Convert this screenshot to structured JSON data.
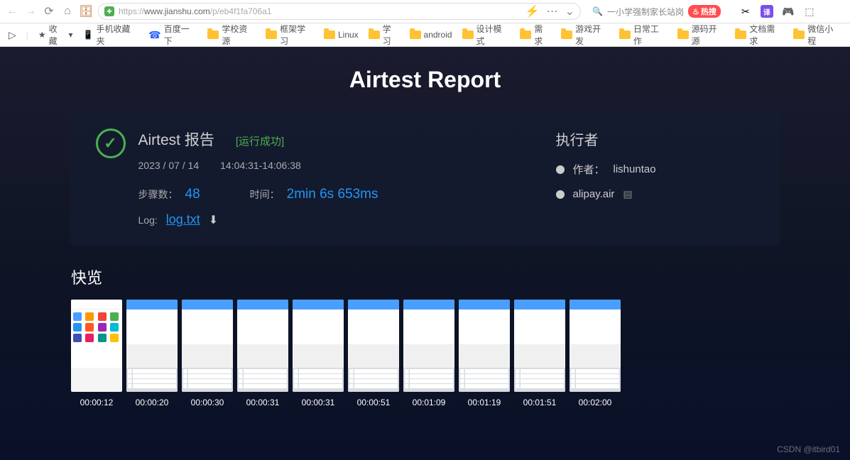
{
  "browser": {
    "url_prefix": "https://",
    "url_host": "www.jianshu.com",
    "url_path": "/p/eb4f1fa706a1",
    "search_placeholder": "一小学强制家长站岗",
    "hot_label": "热搜"
  },
  "bookmarks": {
    "favorites": "收藏",
    "items": [
      {
        "label": "手机收藏夹",
        "type": "phone"
      },
      {
        "label": "百度一下",
        "type": "baidu"
      },
      {
        "label": "学校资源",
        "type": "folder"
      },
      {
        "label": "框架学习",
        "type": "folder"
      },
      {
        "label": "Linux",
        "type": "folder"
      },
      {
        "label": "学习",
        "type": "folder"
      },
      {
        "label": "android",
        "type": "folder"
      },
      {
        "label": "设计模式",
        "type": "folder"
      },
      {
        "label": "需求",
        "type": "folder"
      },
      {
        "label": "游戏开发",
        "type": "folder"
      },
      {
        "label": "日常工作",
        "type": "folder"
      },
      {
        "label": "源码开源",
        "type": "folder"
      },
      {
        "label": "文档需求",
        "type": "folder"
      },
      {
        "label": "微信小程",
        "type": "folder"
      }
    ]
  },
  "report": {
    "main_title": "Airtest Report",
    "sub_title": "Airtest 报告",
    "status": "[运行成功]",
    "date": "2023 / 07 / 14",
    "time_range": "14:04:31-14:06:38",
    "steps_label": "步骤数：",
    "steps_value": "48",
    "duration_label": "时间：",
    "duration_value": "2min 6s 653ms",
    "log_label": "Log:",
    "log_file": "log.txt",
    "executor_title": "执行者",
    "author_label": "作者：",
    "author_name": "lishuntao",
    "script_file": "alipay.air",
    "quickview_title": "快览",
    "thumbnails": [
      {
        "time": "00:00:12"
      },
      {
        "time": "00:00:20"
      },
      {
        "time": "00:00:30"
      },
      {
        "time": "00:00:31"
      },
      {
        "time": "00:00:31"
      },
      {
        "time": "00:00:51"
      },
      {
        "time": "00:01:09"
      },
      {
        "time": "00:01:19"
      },
      {
        "time": "00:01:51"
      },
      {
        "time": "00:02:00"
      }
    ],
    "watermark": "CSDN @itbird01"
  }
}
